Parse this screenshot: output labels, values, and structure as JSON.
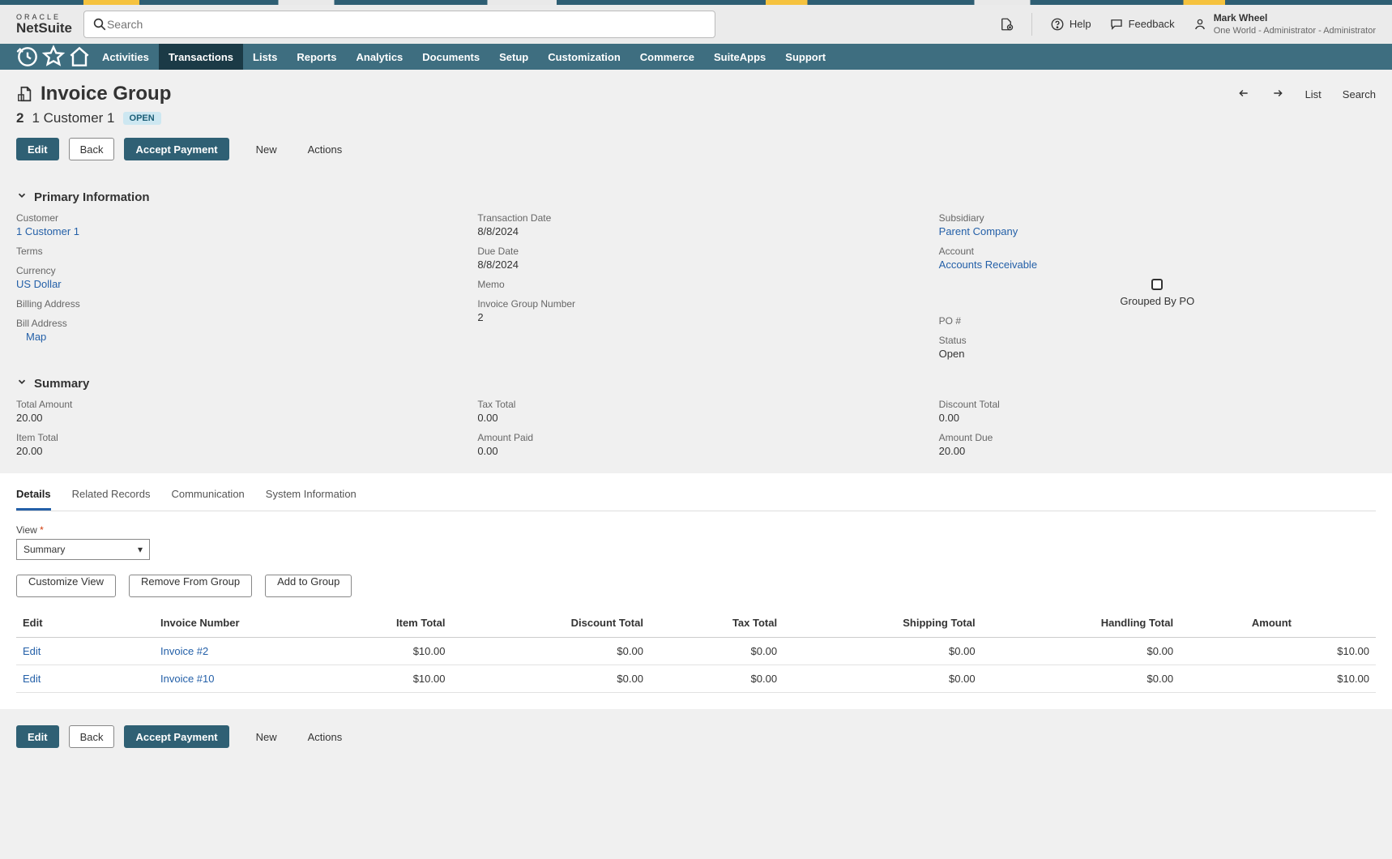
{
  "header": {
    "logo_small": "ORACLE",
    "logo_big": "NetSuite",
    "search_placeholder": "Search",
    "help": "Help",
    "feedback": "Feedback",
    "user": {
      "name": "Mark Wheel",
      "role": "One World - Administrator - Administrator"
    }
  },
  "nav": {
    "items": [
      "Activities",
      "Transactions",
      "Lists",
      "Reports",
      "Analytics",
      "Documents",
      "Setup",
      "Customization",
      "Commerce",
      "SuiteApps",
      "Support"
    ],
    "active_index": 1
  },
  "page": {
    "title": "Invoice Group",
    "id": "2",
    "customer": "1 Customer 1",
    "status_badge": "OPEN",
    "head_right": {
      "list": "List",
      "search": "Search"
    }
  },
  "buttons": {
    "edit": "Edit",
    "back": "Back",
    "accept_payment": "Accept Payment",
    "new": "New",
    "actions": "Actions"
  },
  "primary": {
    "section_title": "Primary Information",
    "left": {
      "customer_label": "Customer",
      "customer_value": "1 Customer 1",
      "terms_label": "Terms",
      "currency_label": "Currency",
      "currency_value": "US Dollar",
      "billing_address_label": "Billing Address",
      "bill_address_label": "Bill Address",
      "map": "Map"
    },
    "mid": {
      "trans_date_label": "Transaction Date",
      "trans_date_value": "8/8/2024",
      "due_date_label": "Due Date",
      "due_date_value": "8/8/2024",
      "memo_label": "Memo",
      "ign_label": "Invoice Group Number",
      "ign_value": "2"
    },
    "right": {
      "subsidiary_label": "Subsidiary",
      "subsidiary_value": "Parent Company",
      "account_label": "Account",
      "account_value": "Accounts Receivable",
      "grouped_label": "Grouped By PO",
      "po_label": "PO #",
      "status_label": "Status",
      "status_value": "Open"
    }
  },
  "summary": {
    "section_title": "Summary",
    "left": {
      "total_amount_label": "Total Amount",
      "total_amount_value": "20.00",
      "item_total_label": "Item Total",
      "item_total_value": "20.00"
    },
    "mid": {
      "tax_total_label": "Tax Total",
      "tax_total_value": "0.00",
      "amount_paid_label": "Amount Paid",
      "amount_paid_value": "0.00"
    },
    "right": {
      "discount_total_label": "Discount Total",
      "discount_total_value": "0.00",
      "amount_due_label": "Amount Due",
      "amount_due_value": "20.00"
    }
  },
  "tabs": {
    "items": [
      "Details",
      "Related Records",
      "Communication",
      "System Information"
    ],
    "active_index": 0
  },
  "details": {
    "view_label": "View",
    "view_value": "Summary",
    "customize_view": "Customize View",
    "remove_from_group": "Remove From Group",
    "add_to_group": "Add to Group",
    "columns": [
      "Edit",
      "Invoice Number",
      "Item Total",
      "Discount Total",
      "Tax Total",
      "Shipping Total",
      "Handling Total",
      "Amount"
    ],
    "rows": [
      {
        "edit": "Edit",
        "invoice": "Invoice #2",
        "item": "$10.00",
        "discount": "$0.00",
        "tax": "$0.00",
        "shipping": "$0.00",
        "handling": "$0.00",
        "amount": "$10.00"
      },
      {
        "edit": "Edit",
        "invoice": "Invoice #10",
        "item": "$10.00",
        "discount": "$0.00",
        "tax": "$0.00",
        "shipping": "$0.00",
        "handling": "$0.00",
        "amount": "$10.00"
      }
    ]
  }
}
